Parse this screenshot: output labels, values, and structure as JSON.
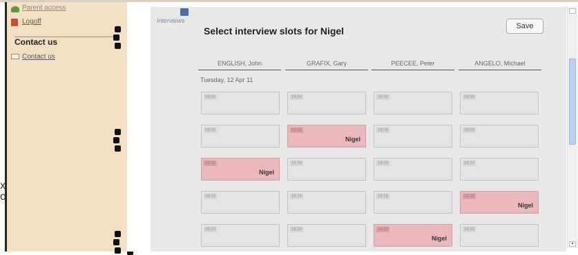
{
  "sidebar": {
    "items": [
      {
        "label": "Parent access",
        "icon": "user-icon"
      },
      {
        "label": "Logoff",
        "icon": "logoff-icon"
      }
    ],
    "contact_heading": "Contact us",
    "contact_link": {
      "label": "Contact us",
      "icon": "mail-icon"
    }
  },
  "edge_fragments": [
    "x",
    "o"
  ],
  "tab": {
    "label": "Interviews",
    "icon": "calendar-icon"
  },
  "page": {
    "title": "Select interview slots for Nigel",
    "save_label": "Save",
    "date": "Tuesday, 12 Apr 11"
  },
  "columns": [
    "ENGLISH, John",
    "GRAFIX, Gary",
    "PEECEE, Peter",
    "ANGELO, Michael"
  ],
  "rows": [
    [
      {
        "time": "16:00",
        "booked": ""
      },
      {
        "time": "16:00",
        "booked": ""
      },
      {
        "time": "16:00",
        "booked": ""
      },
      {
        "time": "16:00",
        "booked": ""
      }
    ],
    [
      {
        "time": "16:05",
        "booked": ""
      },
      {
        "time": "16:05",
        "booked": "Nigel"
      },
      {
        "time": "16:05",
        "booked": ""
      },
      {
        "time": "16:05",
        "booked": ""
      }
    ],
    [
      {
        "time": "16:10",
        "booked": "Nigel"
      },
      {
        "time": "16:10",
        "booked": ""
      },
      {
        "time": "16:10",
        "booked": ""
      },
      {
        "time": "16:10",
        "booked": ""
      }
    ],
    [
      {
        "time": "16:15",
        "booked": ""
      },
      {
        "time": "16:15",
        "booked": ""
      },
      {
        "time": "16:15",
        "booked": ""
      },
      {
        "time": "16:15",
        "booked": "Nigel"
      }
    ],
    [
      {
        "time": "16:20",
        "booked": ""
      },
      {
        "time": "16:20",
        "booked": ""
      },
      {
        "time": "16:20",
        "booked": "Nigel"
      },
      {
        "time": "16:20",
        "booked": ""
      }
    ]
  ],
  "colors": {
    "sidebar_bg": "#f3dfc4",
    "binder": "#1e2a1e",
    "content_bg": "#e8e8e8",
    "slot_free": "#e4e4e4",
    "slot_booked": "#ebb9bc",
    "scroll_thumb": "#b9d2f2"
  }
}
